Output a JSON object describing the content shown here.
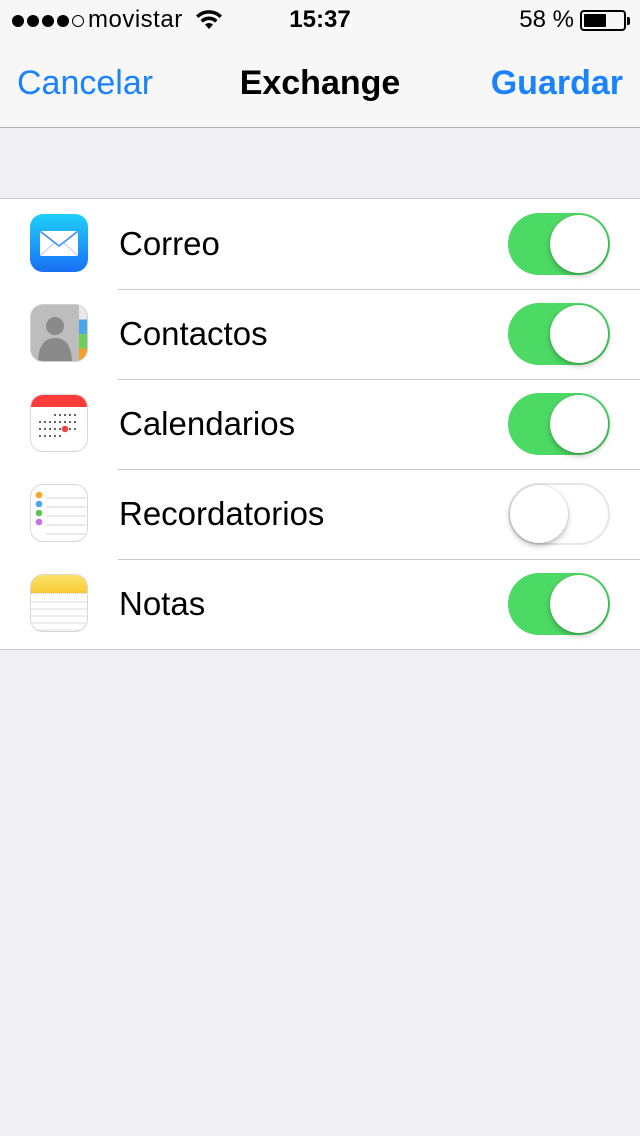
{
  "status_bar": {
    "carrier": "movistar",
    "time": "15:37",
    "battery_percent": "58 %",
    "battery_level": 0.58,
    "signal_bars_filled": 4,
    "signal_bars_total": 5
  },
  "nav": {
    "cancel_label": "Cancelar",
    "title": "Exchange",
    "save_label": "Guardar"
  },
  "colors": {
    "accent": "#1a82fb",
    "toggle_on": "#4cd964",
    "background": "#efeff4"
  },
  "items": [
    {
      "label": "Correo",
      "icon": "mail-icon",
      "enabled": true
    },
    {
      "label": "Contactos",
      "icon": "contacts-icon",
      "enabled": true
    },
    {
      "label": "Calendarios",
      "icon": "calendar-icon",
      "enabled": true
    },
    {
      "label": "Recordatorios",
      "icon": "reminders-icon",
      "enabled": false
    },
    {
      "label": "Notas",
      "icon": "notes-icon",
      "enabled": true
    }
  ]
}
